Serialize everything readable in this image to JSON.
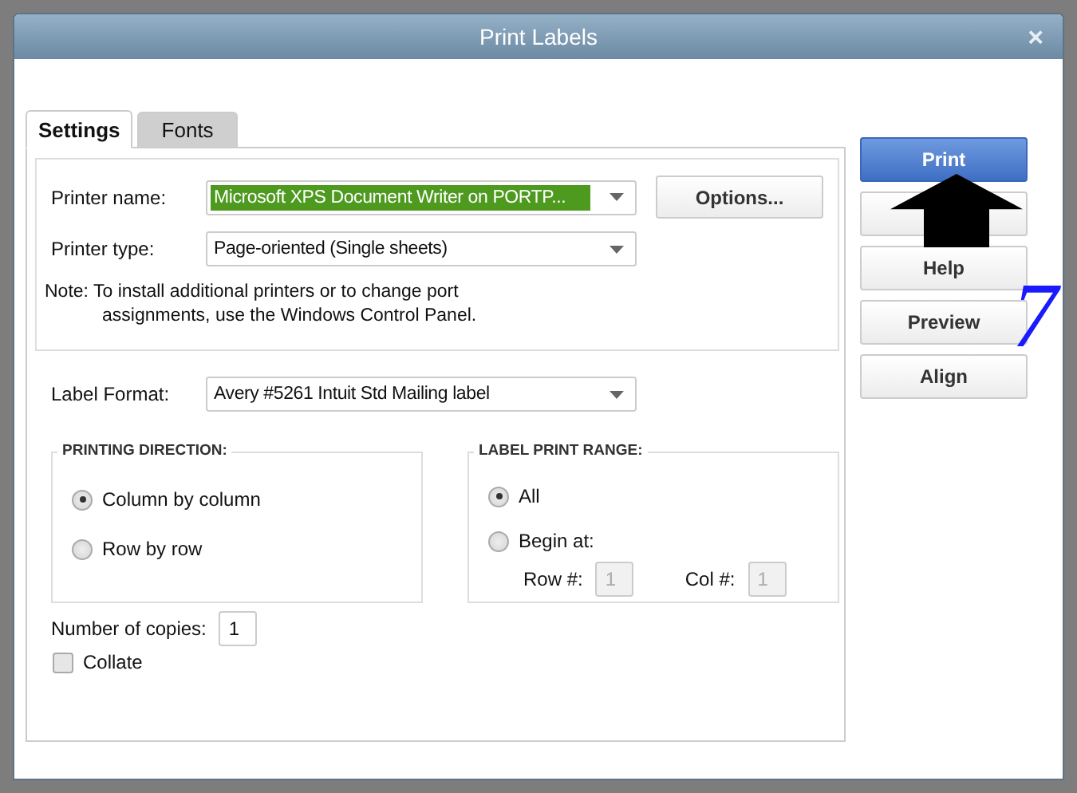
{
  "window": {
    "title": "Print Labels",
    "close": "×"
  },
  "tabs": [
    {
      "label": "Settings",
      "selected": true
    },
    {
      "label": "Fonts",
      "selected": false
    }
  ],
  "printer": {
    "name_label": "Printer name:",
    "name_value": "Microsoft XPS Document Writer on PORTP...",
    "name_highlighted": true,
    "options_button": "Options...",
    "type_label": "Printer type:",
    "type_value": "Page-oriented (Single sheets)",
    "note_lines": [
      "Note: To install additional printers or to change port",
      "assignments, use the Windows Control Panel."
    ]
  },
  "label_format": {
    "label": "Label Format:",
    "value": "Avery #5261 Intuit Std Mailing label"
  },
  "printing_direction": {
    "title": "PRINTING DIRECTION:",
    "options": [
      {
        "label": "Column by column",
        "selected": true
      },
      {
        "label": "Row by row",
        "selected": false
      }
    ]
  },
  "label_print_range": {
    "title": "LABEL PRINT RANGE:",
    "options": [
      {
        "label": "All",
        "selected": true
      },
      {
        "label": "Begin at:",
        "selected": false
      }
    ],
    "row_label": "Row #:",
    "row_value": "1",
    "col_label": "Col #:",
    "col_value": "1",
    "disabled": true
  },
  "copies": {
    "label": "Number of copies:",
    "value": "1"
  },
  "collate": {
    "label": "Collate",
    "checked": false
  },
  "buttons": [
    {
      "label": "Print",
      "kind": "primary"
    },
    {
      "kind": "hidden"
    },
    {
      "label": "Help",
      "kind": "default"
    },
    {
      "label": "Preview",
      "kind": "default"
    },
    {
      "label": "Align",
      "kind": "default"
    }
  ],
  "annotation": {
    "label": "7"
  }
}
